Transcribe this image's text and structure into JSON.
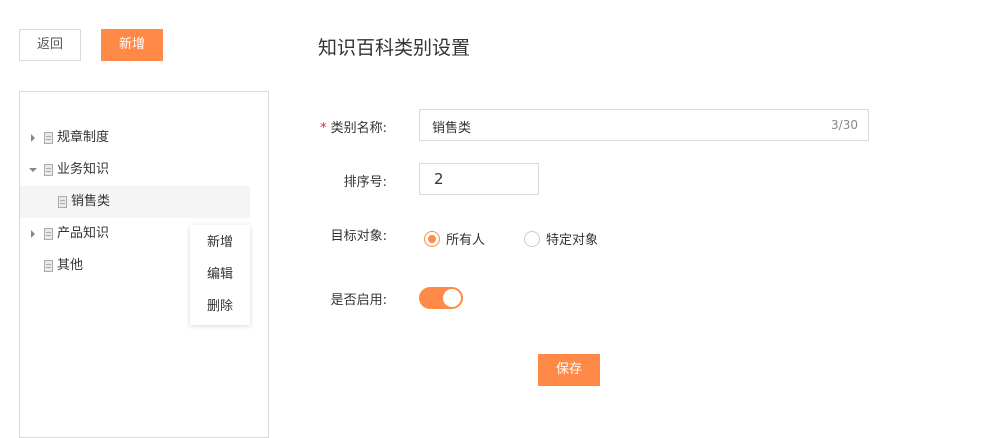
{
  "toolbar": {
    "back_label": "返回",
    "add_label": "新增"
  },
  "page": {
    "title": "知识百科类别设置"
  },
  "tree": {
    "items": [
      {
        "label": "规章制度",
        "expanded": false,
        "has_children": true
      },
      {
        "label": "业务知识",
        "expanded": true,
        "has_children": true
      },
      {
        "label": "销售类",
        "selected": true,
        "child": true
      },
      {
        "label": "产品知识",
        "expanded": false,
        "has_children": true
      },
      {
        "label": "其他",
        "has_children": false
      }
    ]
  },
  "context_menu": {
    "items": [
      "新增",
      "编辑",
      "删除"
    ]
  },
  "form": {
    "name_required_mark": "*",
    "name_label": "类别名称:",
    "name_value": "销售类",
    "name_count": "3/30",
    "order_label": "排序号:",
    "order_value": "2",
    "target_label": "目标对象:",
    "target_options": [
      {
        "label": "所有人",
        "selected": true
      },
      {
        "label": "特定对象",
        "selected": false
      }
    ],
    "enabled_label": "是否启用:",
    "enabled": true,
    "save_label": "保存"
  },
  "colors": {
    "accent": "#ff8a47",
    "border": "#d9d9d9",
    "required": "#f5222d"
  }
}
